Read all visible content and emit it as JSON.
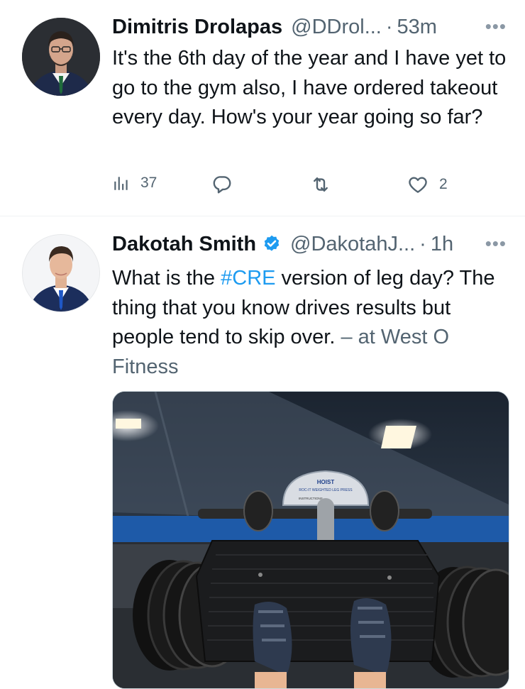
{
  "tweets": [
    {
      "name": "Dimitris Drolapas",
      "handle": "@DDrol...",
      "time": "53m",
      "text": "It's the 6th day of the year and I have yet to go to the gym also, I have ordered takeout every day. How's your year going so far?",
      "stats": {
        "views": "37",
        "likes": "2"
      }
    },
    {
      "name": "Dakotah Smith",
      "handle": "@DakotahJ...",
      "time": "1h",
      "text_before": "What is the ",
      "hashtag": "#CRE",
      "text_after": " version of leg day? The thing that you know drives results but people tend to skip over.",
      "location": "– at West O Fitness",
      "verified": true,
      "media": {
        "machine_label": "HOIST",
        "machine_sublabel": "ROC-IT WEIGHTED LEG PRESS",
        "placard_title": "INSTRUCTIONS"
      }
    }
  ],
  "separator": "·",
  "more_glyph": "•••",
  "colors": {
    "link": "#1d9bf0",
    "muted": "#536471",
    "text": "#0f1419"
  },
  "icons": [
    "analytics-icon",
    "reply-icon",
    "retweet-icon",
    "like-icon",
    "more-icon",
    "verified-badge-icon"
  ]
}
